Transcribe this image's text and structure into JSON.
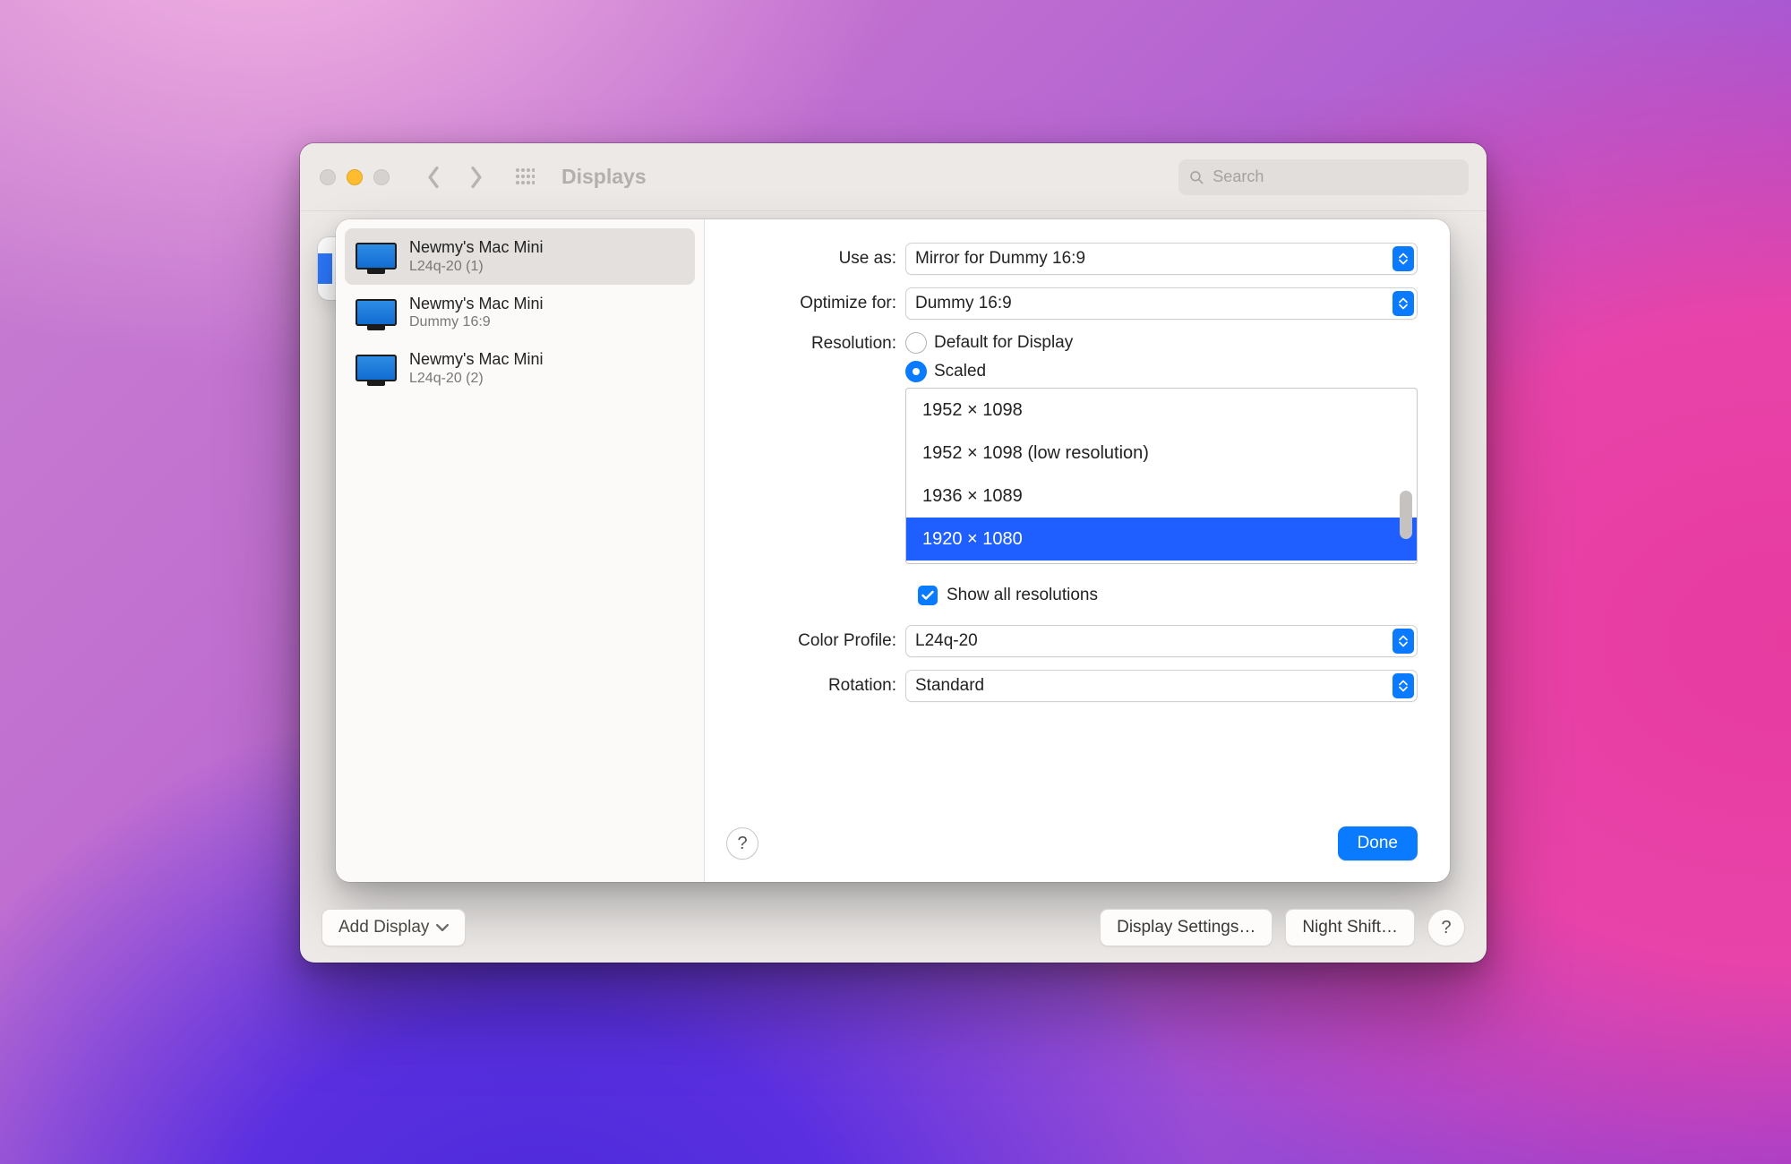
{
  "window": {
    "title": "Displays",
    "search_placeholder": "Search"
  },
  "sidebar": {
    "items": [
      {
        "title": "Newmy's Mac Mini",
        "sub": "L24q-20 (1)",
        "selected": true
      },
      {
        "title": "Newmy's Mac Mini",
        "sub": "Dummy 16:9",
        "selected": false
      },
      {
        "title": "Newmy's Mac Mini",
        "sub": "L24q-20 (2)",
        "selected": false
      }
    ]
  },
  "labels": {
    "use_as": "Use as:",
    "optimize_for": "Optimize for:",
    "resolution": "Resolution:",
    "color_profile": "Color Profile:",
    "rotation": "Rotation:"
  },
  "values": {
    "use_as": "Mirror for Dummy 16:9",
    "optimize_for": "Dummy 16:9",
    "color_profile": "L24q-20",
    "rotation": "Standard"
  },
  "resolution": {
    "default_label": "Default for Display",
    "scaled_label": "Scaled",
    "mode": "scaled",
    "show_all_label": "Show all resolutions",
    "show_all_checked": true,
    "items": [
      {
        "label": "1952 × 1098",
        "selected": false
      },
      {
        "label": "1952 × 1098 (low resolution)",
        "selected": false
      },
      {
        "label": "1936 × 1089",
        "selected": false
      },
      {
        "label": "1920 × 1080",
        "selected": true
      }
    ]
  },
  "sheet_buttons": {
    "help": "?",
    "done": "Done"
  },
  "bottom": {
    "add_display": "Add Display",
    "display_settings": "Display Settings…",
    "night_shift": "Night Shift…",
    "help": "?"
  }
}
